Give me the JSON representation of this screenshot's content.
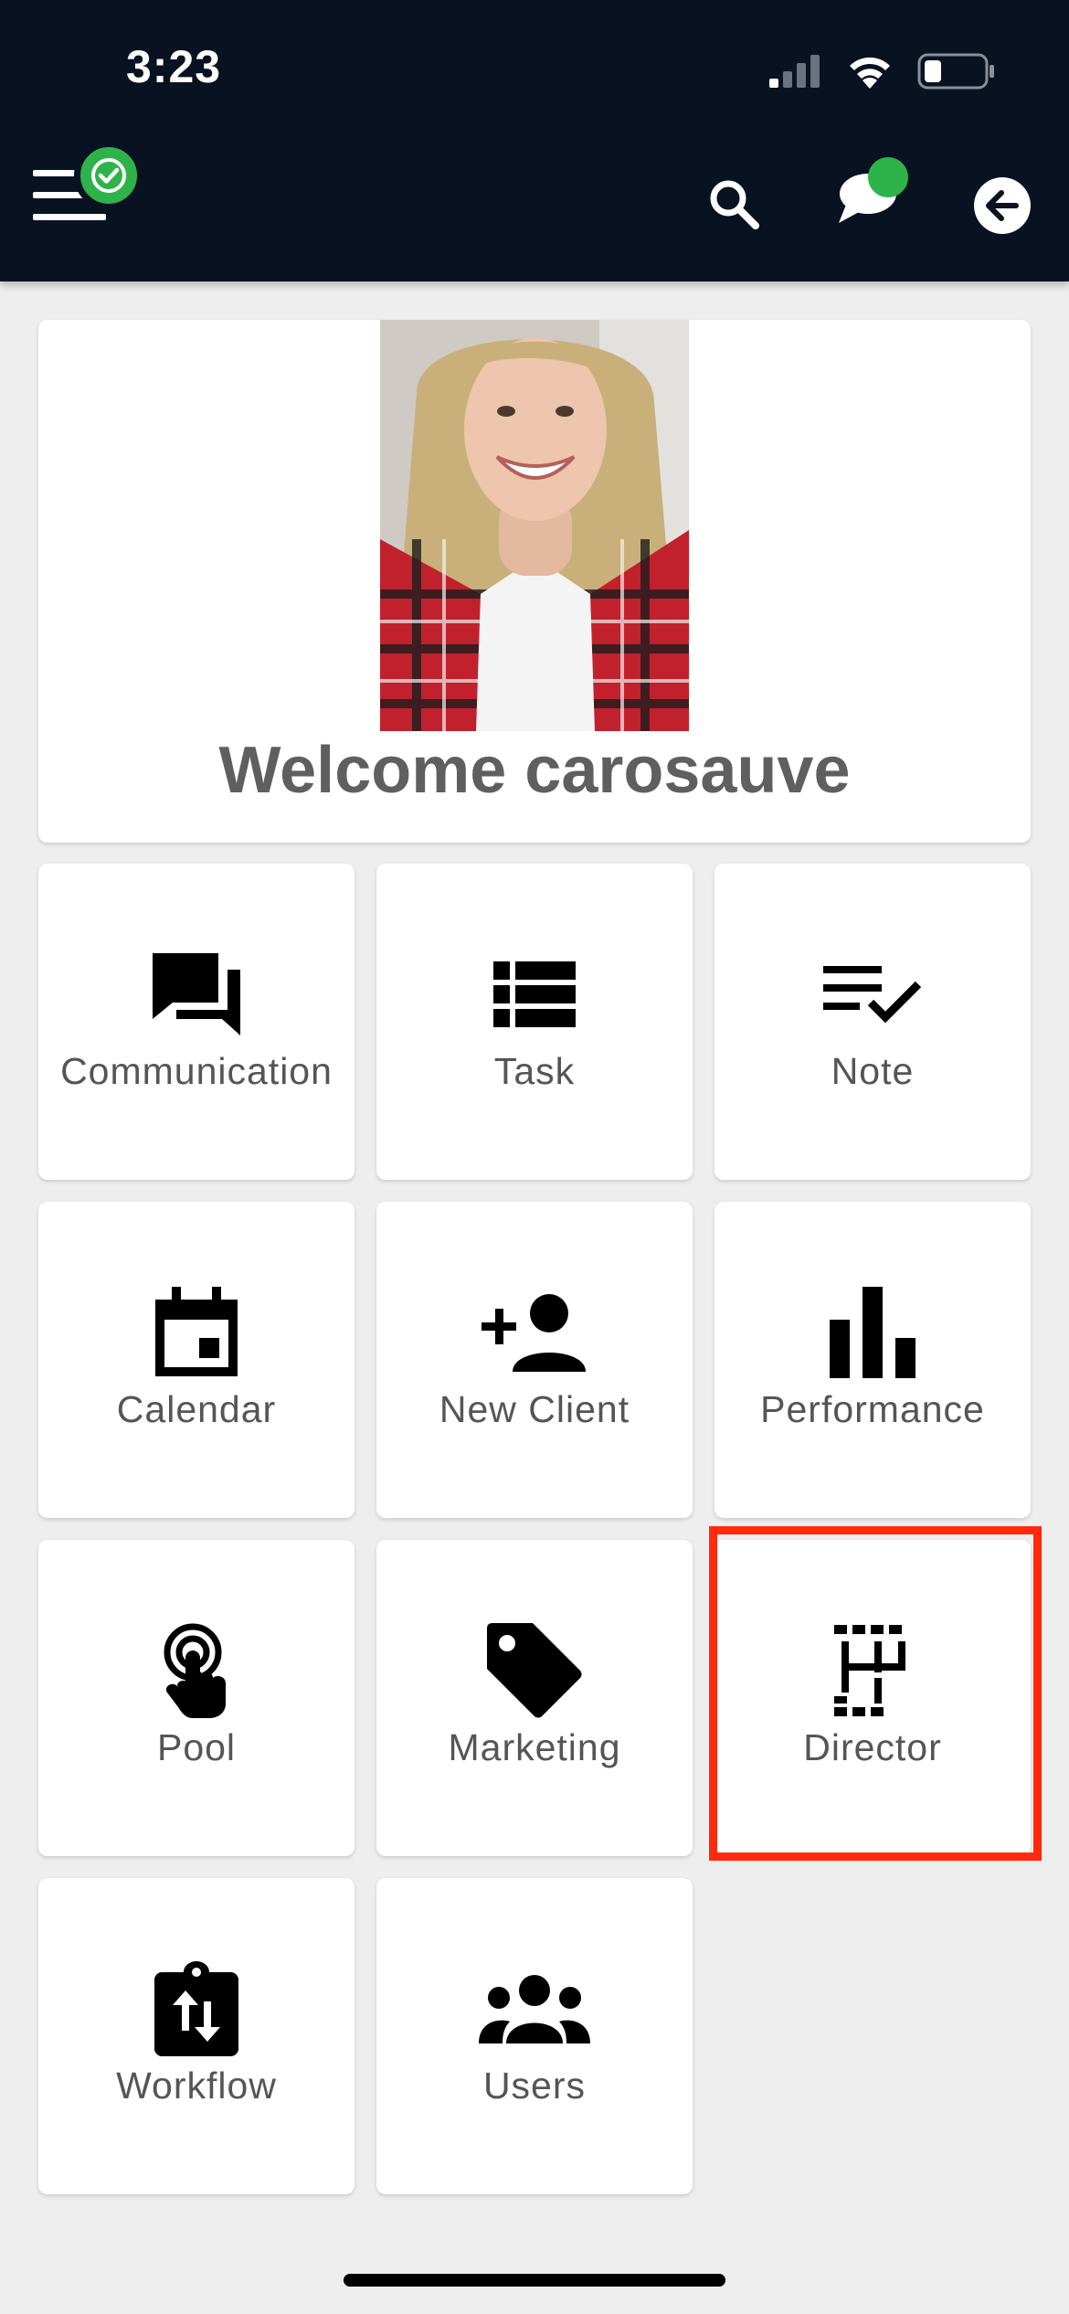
{
  "status_bar": {
    "time": "3:23",
    "icons": [
      "cellular-signal-icon",
      "wifi-icon",
      "battery-icon"
    ]
  },
  "header": {
    "left": [
      "menu-icon",
      "check-badge-icon"
    ],
    "right": [
      "search-icon",
      "chat-icon",
      "back-arrow-icon"
    ],
    "badge_color": "#2db34a",
    "background": "#081221"
  },
  "welcome": {
    "text": "Welcome carosauve"
  },
  "tiles": [
    {
      "label": "Communication",
      "icon": "forum-icon"
    },
    {
      "label": "Task",
      "icon": "list-icon"
    },
    {
      "label": "Note",
      "icon": "checklist-icon"
    },
    {
      "label": "Calendar",
      "icon": "calendar-icon"
    },
    {
      "label": "New Client",
      "icon": "person-add-icon"
    },
    {
      "label": "Performance",
      "icon": "bar-chart-icon"
    },
    {
      "label": "Pool",
      "icon": "touch-icon"
    },
    {
      "label": "Marketing",
      "icon": "tag-icon"
    },
    {
      "label": "Director",
      "icon": "director-icon"
    },
    {
      "label": "Workflow",
      "icon": "swap-clipboard-icon"
    },
    {
      "label": "Users",
      "icon": "group-icon"
    }
  ],
  "highlight_color": "#ff2a0d"
}
